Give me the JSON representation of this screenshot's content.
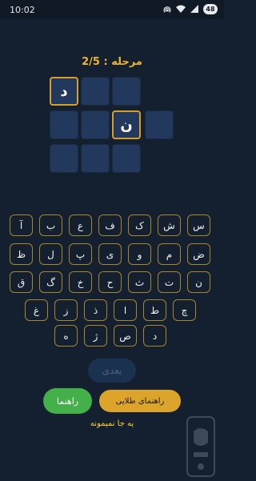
{
  "status_bar": {
    "time": "10:02",
    "battery": "48"
  },
  "level": {
    "label": "مرحله : 2/5"
  },
  "puzzle": {
    "row1": [
      "د",
      "",
      ""
    ],
    "row2": [
      "",
      "",
      "ن",
      ""
    ],
    "row3": [
      "",
      "",
      ""
    ]
  },
  "keyboard": {
    "rows": [
      [
        "س",
        "ش",
        "ک",
        "ف",
        "ع",
        "ب",
        "آ"
      ],
      [
        "ض",
        "م",
        "و",
        "ی",
        "پ",
        "ل",
        "ظ"
      ],
      [
        "ن",
        "ت",
        "ث",
        "ح",
        "خ",
        "گ",
        "ق"
      ],
      [
        "چ",
        "ط",
        "ا",
        "ذ",
        "ز",
        "غ"
      ],
      [
        "د",
        "ص",
        "ژ",
        "ه"
      ]
    ]
  },
  "buttons": {
    "next": "بعدی",
    "golden_hint": "راهنمای طلایی",
    "hint": "راهنما"
  },
  "footer": {
    "text": "یه جا نمیمونه"
  }
}
